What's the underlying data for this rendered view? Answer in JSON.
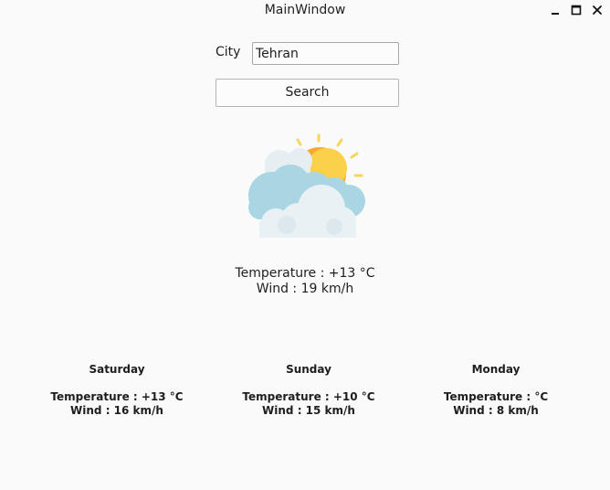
{
  "window": {
    "title": "MainWindow"
  },
  "controls": {
    "minimize_icon": "minimize-icon",
    "maximize_icon": "maximize-icon",
    "close_icon": "close-icon"
  },
  "search": {
    "city_label": "City",
    "city_value": "Tehran",
    "button_label": "Search"
  },
  "current": {
    "icon": "partly-cloudy-icon",
    "temperature_text": "Temperature : +13 °C",
    "wind_text": "Wind : 19 km/h"
  },
  "forecast": [
    {
      "day": "Saturday",
      "temperature_text": "Temperature : +13 °C",
      "wind_text": "Wind : 16 km/h"
    },
    {
      "day": "Sunday",
      "temperature_text": "Temperature : +10 °C",
      "wind_text": "Wind : 15 km/h"
    },
    {
      "day": "Monday",
      "temperature_text": "Temperature :  °C",
      "wind_text": "Wind : 8 km/h"
    }
  ],
  "colors": {
    "background": "#fafafa",
    "sun": "#f9a832",
    "sun_highlight": "#fbd14b",
    "cloud_blue": "#a9d6e2",
    "cloud_white": "#e9f1f4"
  }
}
